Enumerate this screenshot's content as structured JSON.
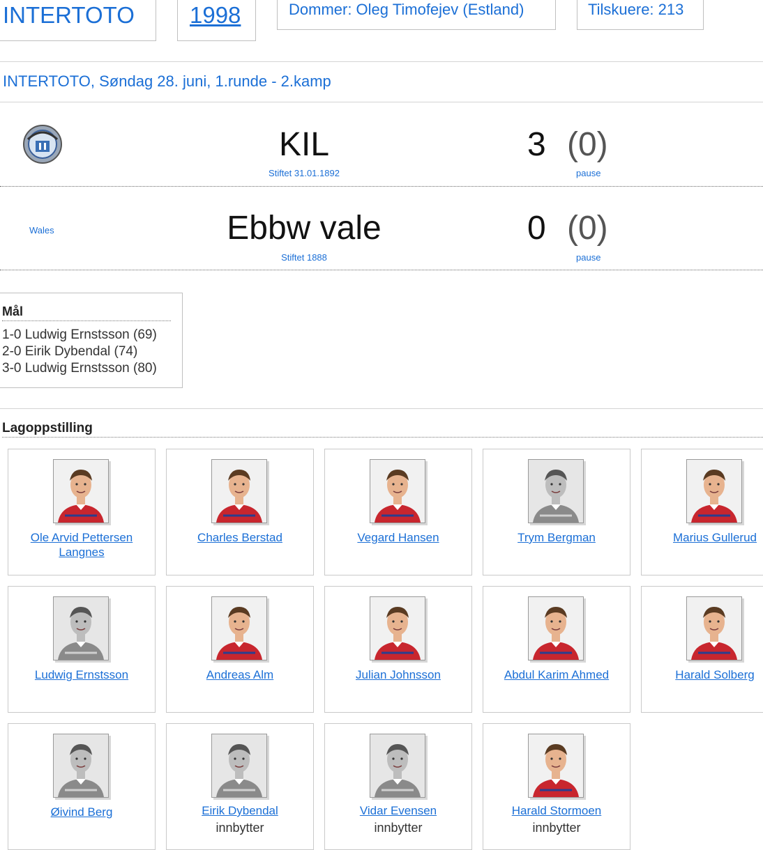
{
  "header": {
    "tournament": "INTERTOTO",
    "year": "1998",
    "referee": "Dommer: Oleg Timofejev (Estland)",
    "attendance": "Tilskuere: 213"
  },
  "match_info": "INTERTOTO, Søndag 28. juni, 1.runde - 2.kamp",
  "home": {
    "name": "KIL",
    "founded": "Stiftet 31.01.1892",
    "score": "3",
    "halftime": "(0)",
    "halftime_label": "pause",
    "crest_icon": "club-crest-icon"
  },
  "away": {
    "country": "Wales",
    "name": "Ebbw vale",
    "founded": "Stiftet 1888",
    "score": "0",
    "halftime": "(0)",
    "halftime_label": "pause"
  },
  "goals": {
    "title": "Mål",
    "items": [
      "1-0 Ludwig Ernstsson (69)",
      "2-0 Eirik Dybendal (74)",
      "3-0 Ludwig Ernstsson (80)"
    ]
  },
  "lineup": {
    "title": "Lagoppstilling",
    "players": [
      {
        "name": "Ole Arvid Pettersen Langnes",
        "role": "",
        "photo": "color"
      },
      {
        "name": "Charles Berstad",
        "role": "",
        "photo": "color"
      },
      {
        "name": "Vegard Hansen",
        "role": "",
        "photo": "color"
      },
      {
        "name": "Trym Bergman",
        "role": "",
        "photo": "gray"
      },
      {
        "name": "Marius Gullerud",
        "role": "",
        "photo": "color"
      },
      {
        "name": "Ludwig Ernstsson",
        "role": "",
        "photo": "gray"
      },
      {
        "name": "Andreas Alm",
        "role": "",
        "photo": "color"
      },
      {
        "name": "Julian Johnsson",
        "role": "",
        "photo": "color"
      },
      {
        "name": "Abdul Karim Ahmed",
        "role": "",
        "photo": "color"
      },
      {
        "name": "Harald Solberg",
        "role": "",
        "photo": "color"
      },
      {
        "name": "Øivind Berg",
        "role": "",
        "photo": "gray"
      },
      {
        "name": "Eirik Dybendal",
        "role": "innbytter",
        "photo": "gray"
      },
      {
        "name": "Vidar Evensen",
        "role": "innbytter",
        "photo": "gray"
      },
      {
        "name": "Harald Stormoen",
        "role": "innbytter",
        "photo": "color"
      }
    ]
  },
  "colors": {
    "link": "#1b6fd6",
    "jersey_red": "#c8262e"
  }
}
